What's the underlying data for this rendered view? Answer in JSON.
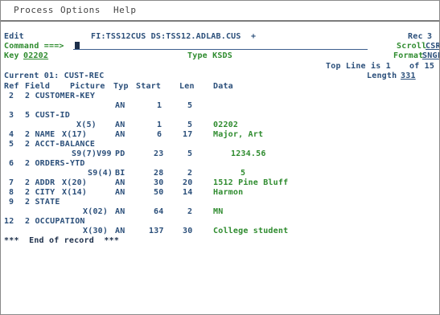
{
  "menu": [
    "Process",
    "Options",
    "Help"
  ],
  "header": {
    "edit_label": "Edit",
    "dataset": "FI:TSS12CUS DS:TSS12.ADLAB.CUS  +",
    "rec_label": "Rec",
    "rec_value": "3",
    "command_label": "Command ===>",
    "scroll_label": "Scroll",
    "scroll_value": "CSR",
    "key_label": "Key",
    "key_value": "02202",
    "type_label": "Type KSDS",
    "format_label": "Format",
    "format_value": "SNGL",
    "top_line_text": "Top Line is 1",
    "of_text": "of 15",
    "current_text": "Current 01: CUST-REC",
    "length_label": "Length",
    "length_value": "331"
  },
  "columns": {
    "ref": "Ref",
    "field": "Field",
    "picture": "Picture",
    "typ": "Typ",
    "start": "Start",
    "len": "Len",
    "data": "Data"
  },
  "rows": [
    {
      "ref": "2",
      "name": "2 CUSTOMER-KEY",
      "picture": "",
      "typ": "",
      "start": "",
      "len": "",
      "data": ""
    },
    {
      "ref": "",
      "name": "",
      "picture": "",
      "typ": "AN",
      "start": "1",
      "len": "5",
      "data": ""
    },
    {
      "ref": "3",
      "name": "5 CUST-ID",
      "picture": "",
      "typ": "",
      "start": "",
      "len": "",
      "data": ""
    },
    {
      "ref": "",
      "name": "",
      "picture": "X(5)",
      "typ": "AN",
      "start": "1",
      "len": "5",
      "data": "02202"
    },
    {
      "ref": "4",
      "name": "2 NAME",
      "picture": "X(17)",
      "typ": "AN",
      "start": "6",
      "len": "17",
      "data": "Major, Art"
    },
    {
      "ref": "5",
      "name": "2 ACCT-BALANCE",
      "picture": "",
      "typ": "",
      "start": "",
      "len": "",
      "data": ""
    },
    {
      "ref": "",
      "name": "",
      "picture": "S9(7)V99",
      "typ": "PD",
      "start": "23",
      "len": "5",
      "data": "1234.56"
    },
    {
      "ref": "6",
      "name": "2 ORDERS-YTD",
      "picture": "",
      "typ": "",
      "start": "",
      "len": "",
      "data": ""
    },
    {
      "ref": "",
      "name": "",
      "picture": "S9(4)",
      "typ": "BI",
      "start": "28",
      "len": "2",
      "data": "5"
    },
    {
      "ref": "7",
      "name": "2 ADDR",
      "picture": "X(20)",
      "typ": "AN",
      "start": "30",
      "len": "20",
      "data": "1512 Pine Bluff"
    },
    {
      "ref": "8",
      "name": "2 CITY",
      "picture": "X(14)",
      "typ": "AN",
      "start": "50",
      "len": "14",
      "data": "Harmon"
    },
    {
      "ref": "9",
      "name": "2 STATE",
      "picture": "",
      "typ": "",
      "start": "",
      "len": "",
      "data": ""
    },
    {
      "ref": "",
      "name": "",
      "picture": "X(02)",
      "typ": "AN",
      "start": "64",
      "len": "2",
      "data": "MN"
    },
    {
      "ref": "12",
      "name": "2 OCCUPATION",
      "picture": "",
      "typ": "",
      "start": "",
      "len": "",
      "data": ""
    },
    {
      "ref": "",
      "name": "",
      "picture": "X(30)",
      "typ": "AN",
      "start": "137",
      "len": "30",
      "data": "College student"
    }
  ],
  "footer": "***  End of record  ***"
}
